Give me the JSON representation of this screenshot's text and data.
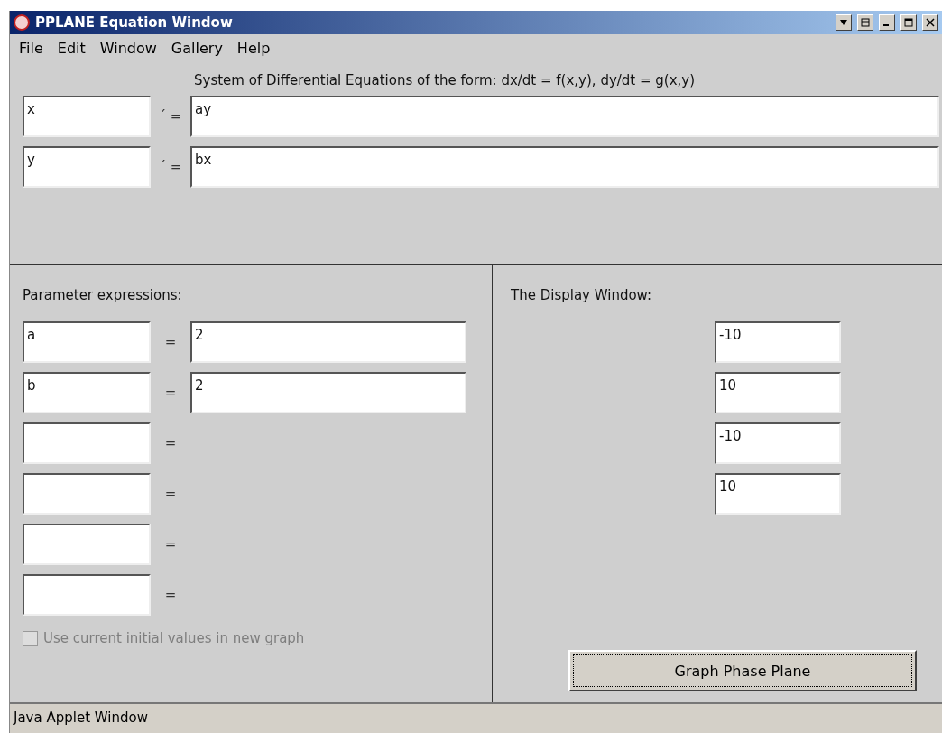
{
  "window": {
    "title": "PPLANE Equation Window"
  },
  "menu": [
    "File",
    "Edit",
    "Window",
    "Gallery",
    "Help"
  ],
  "equations": {
    "heading": "System of Differential Equations of the form: dx/dt = f(x,y), dy/dt = g(x,y)",
    "rows": [
      {
        "variable": "x",
        "operator": "´ =",
        "rhs": "ay"
      },
      {
        "variable": "y",
        "operator": "´ =",
        "rhs": "bx"
      }
    ]
  },
  "parameters": {
    "heading": "Parameter expressions:",
    "rows": [
      {
        "kind": "pair",
        "name": "a",
        "operator": "=",
        "value": "2"
      },
      {
        "kind": "pair",
        "name": "b",
        "operator": "=",
        "value": "2"
      },
      {
        "kind": "blank",
        "operator": "="
      },
      {
        "kind": "blank",
        "operator": "="
      },
      {
        "kind": "blank",
        "operator": "="
      },
      {
        "kind": "blank",
        "operator": "="
      }
    ],
    "checkbox": {
      "label": "Use current initial values in new graph",
      "checked": false,
      "disabled": true
    }
  },
  "display": {
    "heading": "The Display Window:",
    "fields": [
      "-10",
      "10",
      "-10",
      "10"
    ],
    "button": "Graph Phase Plane"
  },
  "status_bar": "Java Applet Window"
}
